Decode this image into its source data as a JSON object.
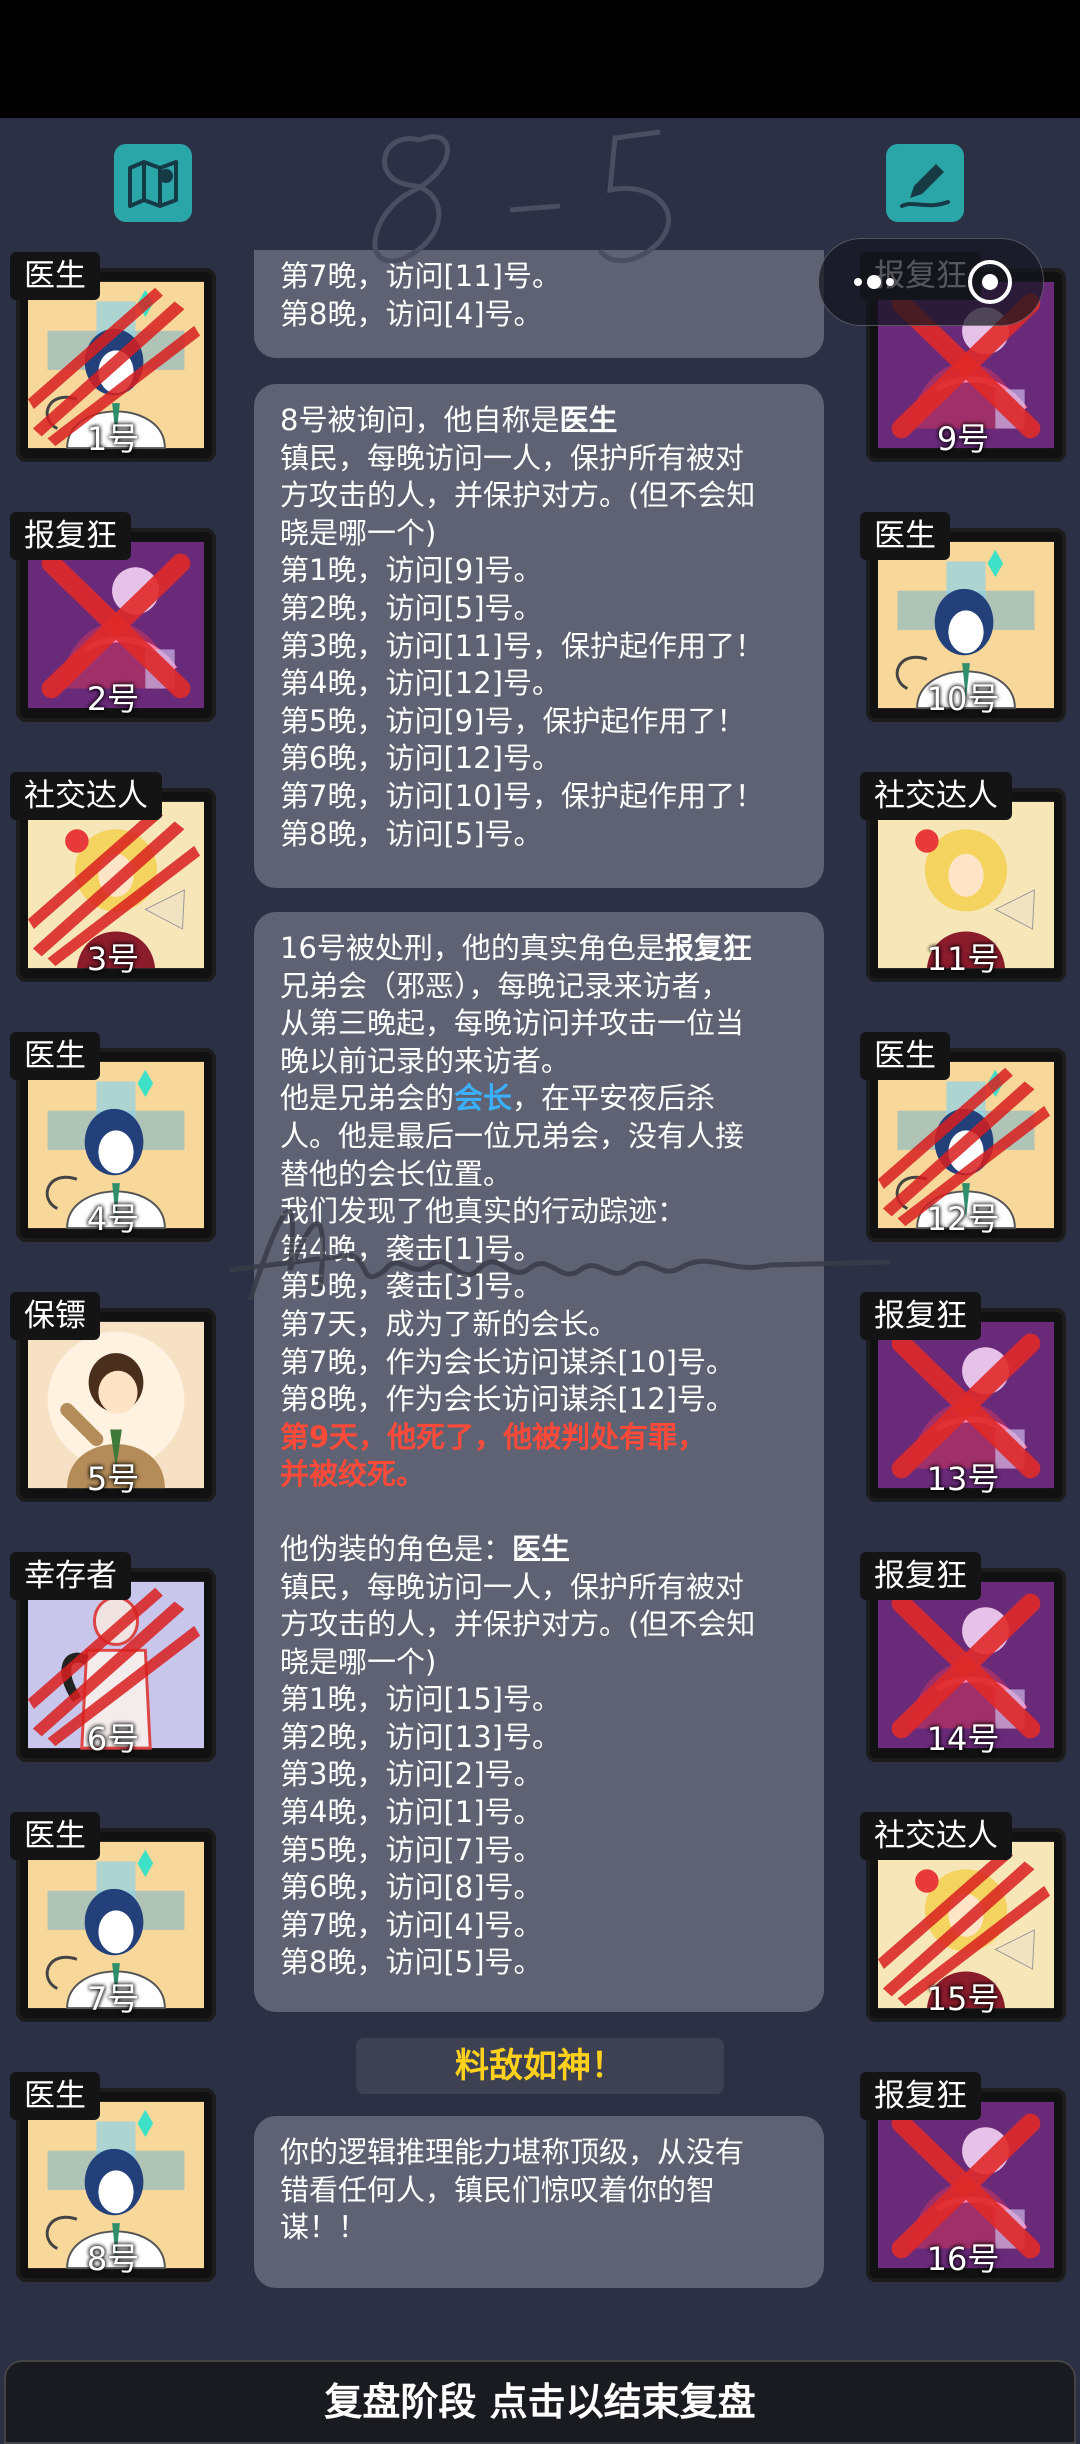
{
  "header": {
    "map_icon": "map-icon",
    "edit_icon": "edit-icon"
  },
  "capsule": {
    "more_icon": "more-dots-icon",
    "close_icon": "target-close-icon"
  },
  "left_players": [
    {
      "role": "医生",
      "number": "1号",
      "art": "doctor",
      "dead": true
    },
    {
      "role": "报复狂",
      "number": "2号",
      "art": "revenger",
      "dead": true
    },
    {
      "role": "社交达人",
      "number": "3号",
      "art": "socialite",
      "dead": true
    },
    {
      "role": "医生",
      "number": "4号",
      "art": "doctor",
      "dead": false
    },
    {
      "role": "保镖",
      "number": "5号",
      "art": "bodyguard",
      "dead": false
    },
    {
      "role": "幸存者",
      "number": "6号",
      "art": "survivor",
      "dead": true
    },
    {
      "role": "医生",
      "number": "7号",
      "art": "doctor",
      "dead": false
    },
    {
      "role": "医生",
      "number": "8号",
      "art": "doctor",
      "dead": false
    }
  ],
  "right_players": [
    {
      "role": "报复狂",
      "number": "9号",
      "art": "revenger",
      "dead": true
    },
    {
      "role": "医生",
      "number": "10号",
      "art": "doctor",
      "dead": false
    },
    {
      "role": "社交达人",
      "number": "11号",
      "art": "socialite",
      "dead": false
    },
    {
      "role": "医生",
      "number": "12号",
      "art": "doctor",
      "dead": true
    },
    {
      "role": "报复狂",
      "number": "13号",
      "art": "revenger",
      "dead": true
    },
    {
      "role": "报复狂",
      "number": "14号",
      "art": "revenger",
      "dead": true
    },
    {
      "role": "社交达人",
      "number": "15号",
      "art": "socialite",
      "dead": true
    },
    {
      "role": "报复狂",
      "number": "16号",
      "art": "revenger",
      "dead": true
    }
  ],
  "messages": {
    "m0": {
      "lines": [
        "第7晚，访问[11]号。",
        "第8晚，访问[4]号。"
      ]
    },
    "m1": {
      "title_prefix": "8号被询问，他自称是",
      "title_role": "医生",
      "lines": [
        "镇民，每晚访问一人，保护所有被对",
        "方攻击的人，并保护对方。(但不会知",
        "晓是哪一个)",
        "第1晚，访问[9]号。",
        "第2晚，访问[5]号。",
        "第3晚，访问[11]号，保护起作用了！",
        "第4晚，访问[12]号。",
        "第5晚，访问[9]号，保护起作用了！",
        "第6晚，访问[12]号。",
        "第7晚，访问[10]号，保护起作用了！",
        "第8晚，访问[5]号。"
      ]
    },
    "m2": {
      "title_prefix": "16号被处刑，他的真实角色是",
      "title_role": "报复狂",
      "lines_a": [
        "兄弟会（邪恶），每晚记录来访者，",
        "从第三晚起，每晚访问并攻击一位当",
        "晚以前记录的来访者。"
      ],
      "leader_prefix": "他是兄弟会的",
      "leader_word": "会长",
      "leader_suffix": "，在平安夜后杀",
      "lines_b": [
        "人。他是最后一位兄弟会，没有人接",
        "替他的会长位置。",
        "我们发现了他真实的行动踪迹：",
        "第4晚，袭击[1]号。",
        "第5晚，袭击[3]号。",
        "第7天，成为了新的会长。",
        "第7晚，作为会长访问谋杀[10]号。",
        "第8晚，作为会长访问谋杀[12]号。"
      ],
      "death_lines": [
        "第9天，他死了，他被判处有罪，",
        "并被绞死。"
      ],
      "disguise_prefix": "他伪装的角色是：",
      "disguise_role": "医生",
      "lines_c": [
        "镇民，每晚访问一人，保护所有被对",
        "方攻击的人，并保护对方。(但不会知",
        "晓是哪一个)",
        "第1晚，访问[15]号。",
        "第2晚，访问[13]号。",
        "第3晚，访问[2]号。",
        "第4晚，访问[1]号。",
        "第5晚，访问[7]号。",
        "第6晚，访问[8]号。",
        "第7晚，访问[4]号。",
        "第8晚，访问[5]号。"
      ]
    },
    "banner": "料敌如神！",
    "m3": {
      "lines": [
        "你的逻辑推理能力堪称顶级，从没有",
        "错看任何人，镇民们惊叹着你的智",
        "谋！！"
      ]
    }
  },
  "overlay_handwriting": {
    "top_text": "8-5"
  },
  "footer": {
    "label": "复盘阶段 点击以结束复盘"
  },
  "colors": {
    "bg": "#2c3045",
    "bubble": "#5e6272",
    "teal_button": "#2aa6a8",
    "blood": "#d81e1e",
    "gold": "#ffd11a",
    "red_text": "#ff4a3a",
    "blue_text": "#3bb0ff"
  }
}
